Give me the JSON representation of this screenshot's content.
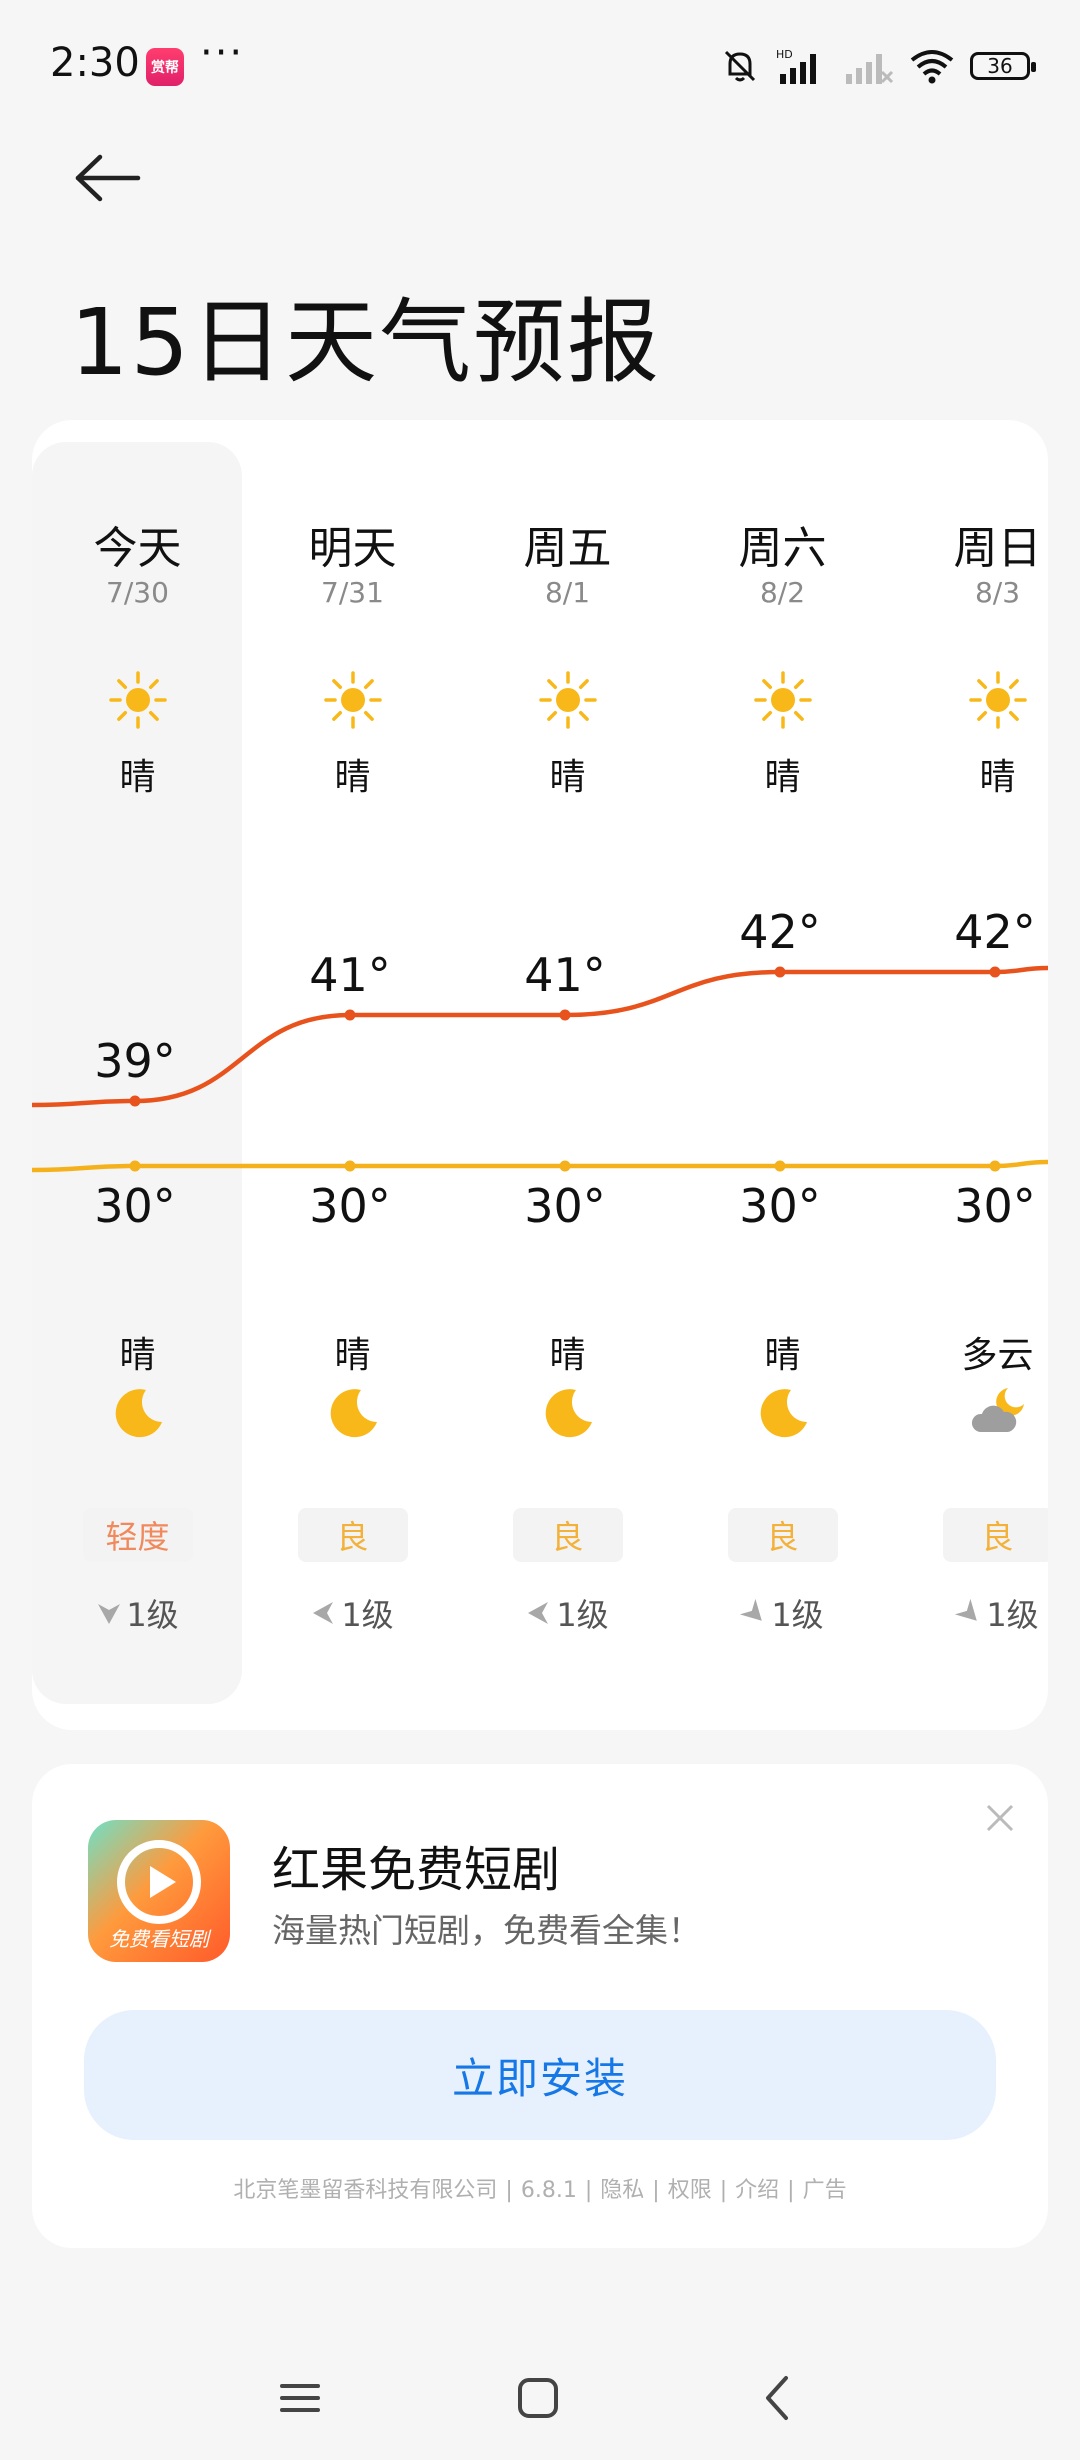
{
  "status_bar": {
    "time": "2:30",
    "app_badge": "赏帮",
    "more": "···",
    "battery": "36",
    "network_label": "HD"
  },
  "page": {
    "title": "15日天气预报"
  },
  "days": [
    {
      "name": "今天",
      "date": "7/30",
      "day_cond": "晴",
      "day_icon": "sun-icon",
      "high": "39°",
      "low": "30°",
      "night_cond": "晴",
      "night_icon": "moon-icon",
      "aqi": "轻度",
      "aqi_color": "#f08a5d",
      "wind": "1级",
      "wind_dir": "down"
    },
    {
      "name": "明天",
      "date": "7/31",
      "day_cond": "晴",
      "day_icon": "sun-icon",
      "high": "41°",
      "low": "30°",
      "night_cond": "晴",
      "night_icon": "moon-icon",
      "aqi": "良",
      "aqi_color": "#f3b13a",
      "wind": "1级",
      "wind_dir": "left"
    },
    {
      "name": "周五",
      "date": "8/1",
      "day_cond": "晴",
      "day_icon": "sun-icon",
      "high": "41°",
      "low": "30°",
      "night_cond": "晴",
      "night_icon": "moon-icon",
      "aqi": "良",
      "aqi_color": "#f3b13a",
      "wind": "1级",
      "wind_dir": "left"
    },
    {
      "name": "周六",
      "date": "8/2",
      "day_cond": "晴",
      "day_icon": "sun-icon",
      "high": "42°",
      "low": "30°",
      "night_cond": "晴",
      "night_icon": "moon-icon",
      "aqi": "良",
      "aqi_color": "#f3b13a",
      "wind": "1级",
      "wind_dir": "down-right"
    },
    {
      "name": "周日",
      "date": "8/3",
      "day_cond": "晴",
      "day_icon": "sun-icon",
      "high": "42°",
      "low": "30°",
      "night_cond": "多云",
      "night_icon": "cloudy-moon-icon",
      "aqi": "良",
      "aqi_color": "#f3b13a",
      "wind": "1级",
      "wind_dir": "down-right"
    }
  ],
  "temps": {
    "high": [
      39,
      41,
      41,
      42,
      42
    ],
    "low": [
      30,
      30,
      30,
      30,
      30
    ]
  },
  "colors": {
    "high_line": "#e8531d",
    "low_line": "#f5b11c",
    "sun": "#f8b81a",
    "moon": "#f8b81a",
    "install_text": "#1677e6"
  },
  "ad": {
    "app_name": "红果免费短剧",
    "subtitle": "海量热门短剧，免费看全集！",
    "logo_caption": "免费看短剧",
    "install_label": "立即安装",
    "footer": [
      "北京笔墨留香科技有限公司",
      "6.8.1",
      "隐私",
      "权限",
      "介绍",
      "广告"
    ]
  }
}
